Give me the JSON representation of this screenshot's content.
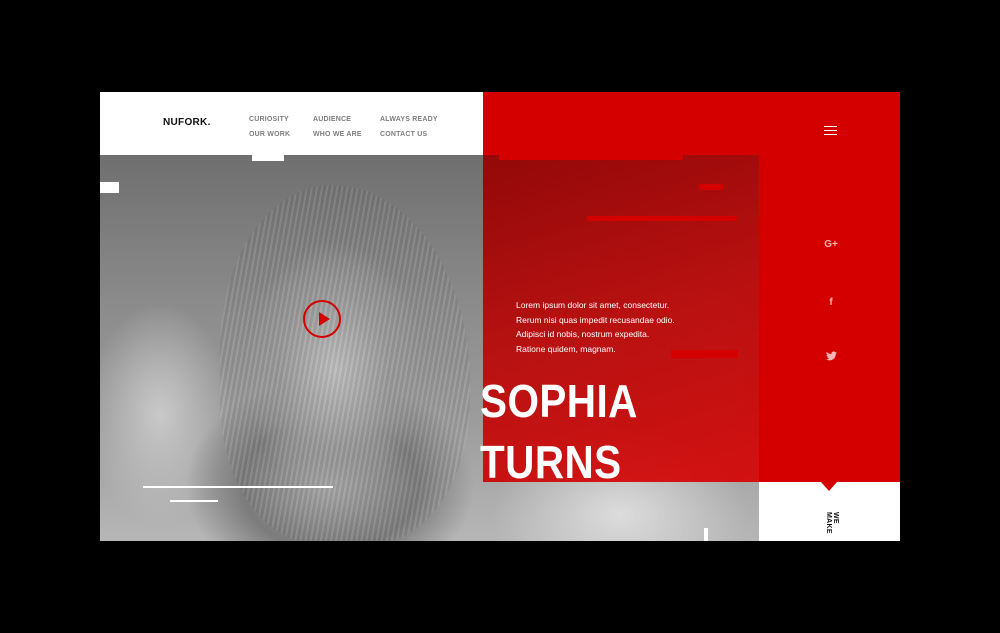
{
  "header": {
    "logo": "NUFORK.",
    "nav": [
      [
        "CURIOSITY",
        "OUR WORK"
      ],
      [
        "AUDIENCE",
        "WHO WE ARE"
      ],
      [
        "ALWAYS READY",
        "CONTACT US"
      ]
    ]
  },
  "social": {
    "google_plus": "G+",
    "facebook": "f",
    "twitter": "t"
  },
  "hero": {
    "paragraph_lines": [
      "Lorem ipsum dolor sit amet, consectetur.",
      "Rerum nisi quas impedit recusandae odio.",
      "Adipisci id nobis, nostrum expedita.",
      "Ratione quidem, magnam."
    ],
    "headline_line1": "SOPHIA",
    "headline_line2": "TURNS"
  },
  "side_label": "WE MAKE",
  "colors": {
    "accent": "#d40000",
    "background": "#000000",
    "panel": "#ffffff"
  },
  "icons": [
    "menu-icon",
    "google-plus-icon",
    "facebook-icon",
    "twitter-icon",
    "play-icon"
  ]
}
